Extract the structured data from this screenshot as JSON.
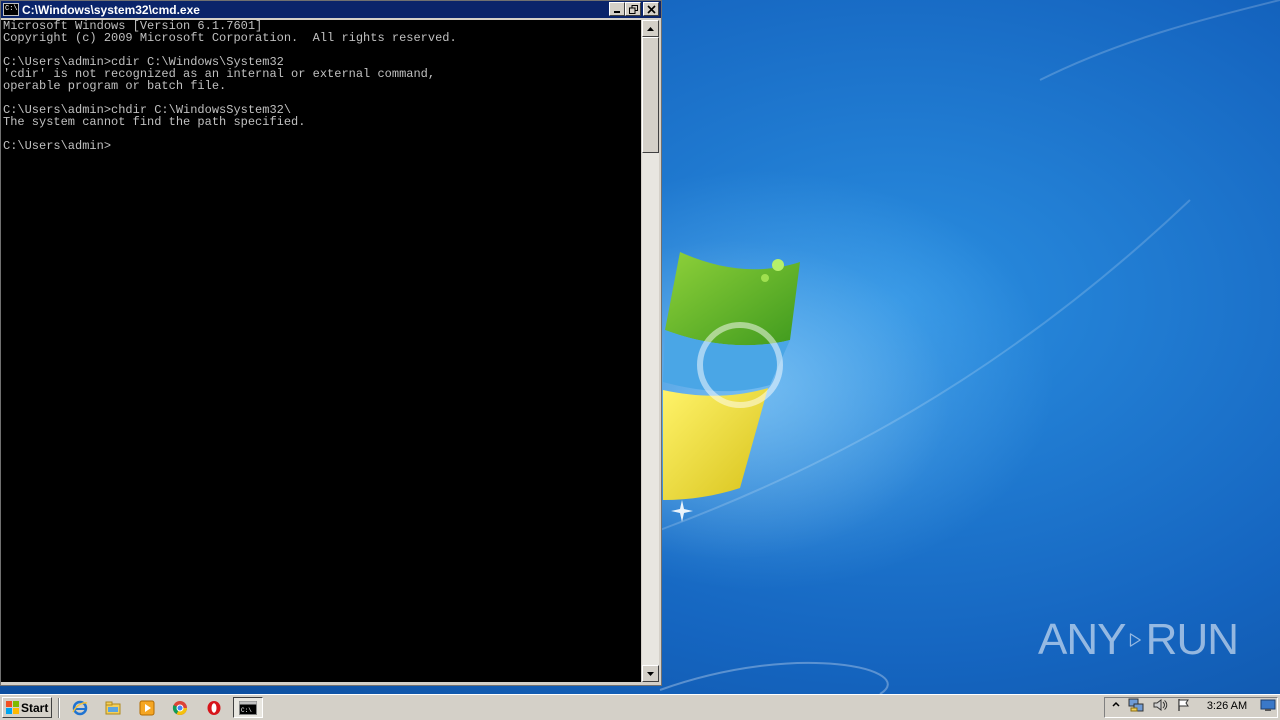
{
  "window": {
    "title": "C:\\Windows\\system32\\cmd.exe",
    "icon_text": "C:\\",
    "controls": {
      "minimize": "minimize-icon",
      "maximize": "restore-icon",
      "close": "close-icon"
    }
  },
  "console": {
    "lines": [
      "Microsoft Windows [Version 6.1.7601]",
      "Copyright (c) 2009 Microsoft Corporation.  All rights reserved.",
      "",
      "C:\\Users\\admin>cdir C:\\Windows\\System32",
      "'cdir' is not recognized as an internal or external command,",
      "operable program or batch file.",
      "",
      "C:\\Users\\admin>chdir C:\\WindowsSystem32\\",
      "The system cannot find the path specified.",
      "",
      "C:\\Users\\admin>"
    ]
  },
  "taskbar": {
    "start_label": "Start",
    "quick_launch": [
      "internet-explorer-icon",
      "windows-explorer-icon",
      "media-player-icon",
      "chrome-icon",
      "opera-icon"
    ],
    "active_task": "cmd-icon",
    "tray_icons": [
      "show-hidden-icons-arrow",
      "network-icon",
      "volume-icon",
      "action-center-flag-icon"
    ],
    "clock": "3:26 AM",
    "show_desktop": "show-desktop-icon"
  },
  "watermark": {
    "left": "ANY",
    "right": "RUN"
  },
  "colors": {
    "console_bg": "#000000",
    "console_fg": "#c0c0c0",
    "titlebar": "#0a246a",
    "taskbar": "#d4d0c8",
    "desktop": "#1a6fc8"
  }
}
